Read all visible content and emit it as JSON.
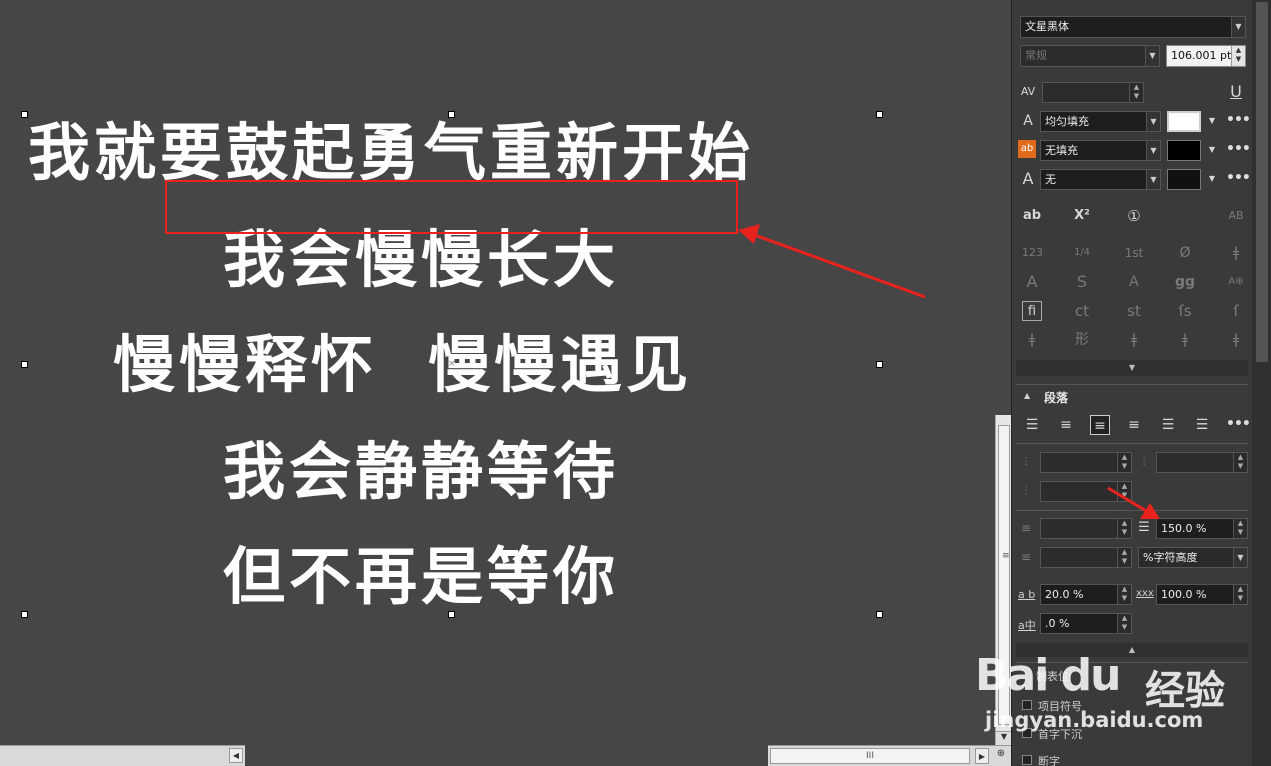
{
  "canvas": {
    "lines": [
      "我就要鼓起勇气重新开始",
      "我会慢慢长大",
      "慢慢释怀  慢慢遇见",
      "我会静静等待",
      "但不再是等你"
    ],
    "annotation_color": "#e8221c"
  },
  "scrollbars": {
    "v_grip": "≡",
    "h_grip": "III"
  },
  "character_panel": {
    "font_family": "文星黑体",
    "font_style": "常规",
    "font_size": "106.001 pt",
    "kerning_value": "",
    "text_fill": "均匀填充",
    "background_fill": "无填充",
    "outline": "无",
    "text_fill_color": "#ffffff",
    "background_fill_color": "#000000",
    "more_label": "•••",
    "icons": {
      "kerning": "kerning-icon",
      "underline": "underline-icon",
      "text-fill": "text-fill-icon",
      "background-fill": "background-fill-icon",
      "outline": "outline-icon"
    },
    "format_buttons": [
      "ab",
      "X²",
      "①",
      "AB"
    ],
    "opentype_rows": [
      [
        "123",
        "1/4",
        "1st",
        "Ø",
        "ǂ"
      ],
      [
        "A",
        "S",
        "Ａ",
        "gg",
        "A⊕"
      ],
      [
        "ﬁ",
        "ct",
        "st",
        "ſs",
        "ſ"
      ],
      [
        "ǂ",
        "形",
        "ǂ",
        "ǂ",
        "ǂ"
      ]
    ],
    "expand_glyph": "▼"
  },
  "paragraph_panel": {
    "title": "段落",
    "collapse_glyph": "▲",
    "alignment_buttons": [
      "none",
      "left",
      "center",
      "right",
      "justify",
      "force-justify"
    ],
    "active_alignment": "center",
    "left_indent": "",
    "first_line_indent": "",
    "right_indent": "",
    "space_before": "",
    "line_spacing": "150.0 %",
    "space_after": "",
    "spacing_unit": "%字符高度",
    "char_spacing_label": "a b",
    "char_spacing": "20.0 %",
    "word_spacing_label": "xxx",
    "word_spacing": "100.0 %",
    "language_spacing_label": "a中",
    "language_spacing": ".0 %"
  },
  "tabs_panel": {
    "title": "制表位",
    "items": [
      "项目符号",
      "首字下沉",
      "断字"
    ]
  },
  "watermark": {
    "logo": "Bai du",
    "chinese": "经验",
    "url": "jingyan.baidu.com"
  }
}
